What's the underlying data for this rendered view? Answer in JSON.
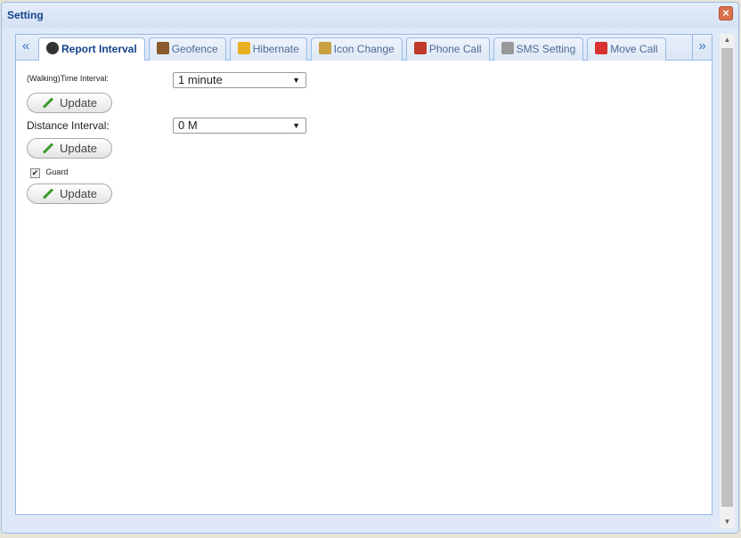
{
  "window": {
    "title": "Setting",
    "close_icon": "close-icon"
  },
  "tabs": [
    {
      "label": "Report Interval",
      "icon": "clock-icon",
      "color": "#333333",
      "active": true
    },
    {
      "label": "Geofence",
      "icon": "fence-icon",
      "color": "#8a5a2b"
    },
    {
      "label": "Hibernate",
      "icon": "hibernate-icon",
      "color": "#e8b020"
    },
    {
      "label": "Icon Change",
      "icon": "image-icon",
      "color": "#c9a040"
    },
    {
      "label": "Phone Call",
      "icon": "phone-icon",
      "color": "#c0392b"
    },
    {
      "label": "SMS Setting",
      "icon": "sms-icon",
      "color": "#999999"
    },
    {
      "label": "Move Call",
      "icon": "car-icon",
      "color": "#d93030"
    }
  ],
  "scroll_left": "«",
  "scroll_right": "»",
  "form": {
    "time_label": "(Walking)Time Interval:",
    "time_value": "1 minute",
    "distance_label": "Distance Interval:",
    "distance_value": "0 M",
    "guard_label": "Guard",
    "guard_checked": true,
    "update_label": "Update"
  }
}
